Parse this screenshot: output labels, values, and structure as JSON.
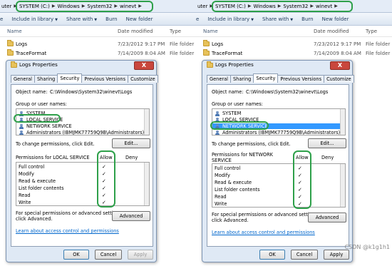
{
  "left": {
    "address": {
      "prefix": "uter",
      "crumbs": [
        "SYSTEM (C:)",
        "Windows",
        "System32",
        "winevt"
      ]
    },
    "toolbar": {
      "organize": "e",
      "include_in_library": "Include in library",
      "share_with": "Share with",
      "burn": "Burn",
      "new_folder": "New folder"
    },
    "columns": {
      "name": "Name",
      "date": "Date modified",
      "type": "Type"
    },
    "files": [
      {
        "name": "Logs",
        "date": "7/23/2012 9:17 PM",
        "type": "File folder"
      },
      {
        "name": "TraceFormat",
        "date": "7/14/2009 8:04 AM",
        "type": "File folder"
      }
    ],
    "dialog": {
      "title": "Logs Properties",
      "close": "X",
      "tabs": [
        "General",
        "Sharing",
        "Security",
        "Previous Versions",
        "Customize"
      ],
      "active_tab": "Security",
      "object_name_label": "Object name:",
      "object_name_value": "C:\\Windows\\System32\\winevt\\Logs",
      "group_label": "Group or user names:",
      "users": [
        "SYSTEM",
        "LOCAL SERVICE",
        "NETWORK SERVICE",
        "Administrators (IBMJMK77759Q9B\\Administrators)"
      ],
      "change_text": "To change permissions, click Edit.",
      "edit_button": "Edit...",
      "perms_for": "Permissions for LOCAL SERVICE",
      "allow": "Allow",
      "deny": "Deny",
      "permissions": [
        "Full control",
        "Modify",
        "Read & execute",
        "List folder contents",
        "Read",
        "Write"
      ],
      "check": "✓",
      "special_text_1": "For special permissions or advanced settings,",
      "special_text_2": "click Advanced.",
      "advanced_button": "Advanced",
      "learn_link": "Learn about access control and permissions",
      "ok": "OK",
      "cancel": "Cancel",
      "apply": "Apply"
    }
  },
  "right": {
    "address": {
      "prefix": "uter",
      "crumbs": [
        "SYSTEM (C:)",
        "Windows",
        "System32",
        "winevt"
      ]
    },
    "toolbar": {
      "organize": "e",
      "include_in_library": "Include in library",
      "share_with": "Share with",
      "burn": "Burn",
      "new_folder": "New folder"
    },
    "columns": {
      "name": "Name",
      "date": "Date modified",
      "type": "Type"
    },
    "files": [
      {
        "name": "Logs",
        "date": "7/23/2012 9:17 PM",
        "type": "File folder"
      },
      {
        "name": "TraceFormat",
        "date": "7/14/2009 8:04 AM",
        "type": "File folder"
      }
    ],
    "dialog": {
      "title": "Logs Properties",
      "close": "X",
      "tabs": [
        "General",
        "Sharing",
        "Security",
        "Previous Versions",
        "Customize"
      ],
      "active_tab": "Security",
      "object_name_label": "Object name:",
      "object_name_value": "C:\\Windows\\System32\\winevt\\Logs",
      "group_label": "Group or user names:",
      "users": [
        "SYSTEM",
        "LOCAL SERVICE",
        "NETWORK SERVICE",
        "Administrators (IBMJMK77759Q9B\\Administrators)"
      ],
      "change_text": "To change permissions, click Edit.",
      "edit_button": "Edit...",
      "perms_for_1": "Permissions for NETWORK",
      "perms_for_2": "SERVICE",
      "allow": "Allow",
      "deny": "Deny",
      "permissions": [
        "Full control",
        "Modify",
        "Read & execute",
        "List folder contents",
        "Read",
        "Write"
      ],
      "check": "✓",
      "special_text_1": "For special permissions or advanced settings,",
      "special_text_2": "click Advanced.",
      "advanced_button": "Advanced",
      "learn_link": "Learn about access control and permissions",
      "ok": "OK",
      "cancel": "Cancel",
      "apply": "Apply"
    },
    "watermark": "CSDN @k1g1h1"
  },
  "colors": {
    "highlight": "#2ea04a",
    "selection": "#3399ff",
    "link": "#0066cc"
  }
}
